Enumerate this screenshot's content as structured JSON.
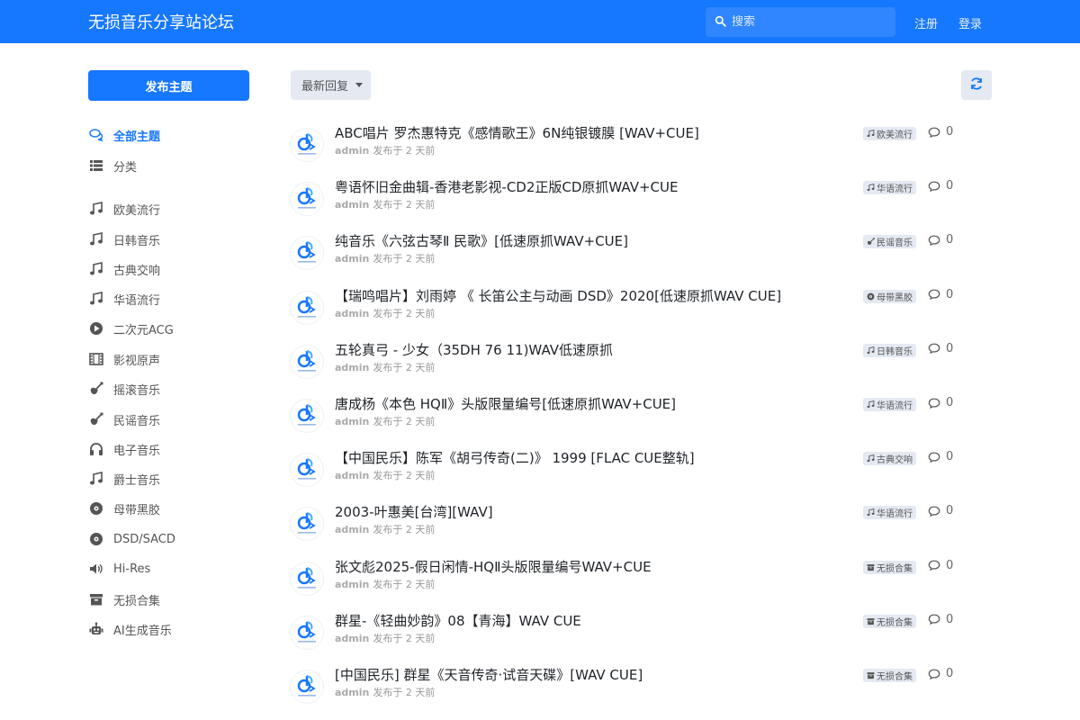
{
  "header": {
    "site_title": "无损音乐分享站论坛",
    "search_placeholder": "搜索",
    "register": "注册",
    "login": "登录"
  },
  "colors": {
    "brand": "#1677ff",
    "tag_bg": "#e4e9f2"
  },
  "sidebar": {
    "post_button": "发布主题",
    "items": [
      {
        "label": "全部主题",
        "icon": "comments-icon",
        "active": true
      },
      {
        "label": "分类",
        "icon": "list-icon"
      },
      {
        "label": "欧美流行",
        "icon": "music-note-icon"
      },
      {
        "label": "日韩音乐",
        "icon": "music-note-icon"
      },
      {
        "label": "古典交响",
        "icon": "music-note-icon"
      },
      {
        "label": "华语流行",
        "icon": "music-note-icon"
      },
      {
        "label": "二次元ACG",
        "icon": "play-circle-icon"
      },
      {
        "label": "影视原声",
        "icon": "film-icon"
      },
      {
        "label": "摇滚音乐",
        "icon": "guitar-icon"
      },
      {
        "label": "民谣音乐",
        "icon": "guitar-icon"
      },
      {
        "label": "电子音乐",
        "icon": "headphones-icon"
      },
      {
        "label": "爵士音乐",
        "icon": "music-note-icon"
      },
      {
        "label": "母带黑胶",
        "icon": "record-icon"
      },
      {
        "label": "DSD/SACD",
        "icon": "record-icon"
      },
      {
        "label": "Hi-Res",
        "icon": "volume-icon"
      },
      {
        "label": "无损合集",
        "icon": "archive-icon"
      },
      {
        "label": "AI生成音乐",
        "icon": "robot-icon"
      }
    ]
  },
  "toolbar": {
    "sort_label": "最新回复"
  },
  "topics": [
    {
      "title": "ABC唱片 罗杰惠特克《感情歌王》6N纯银镀膜 [WAV+CUE]",
      "author": "admin",
      "time": "发布于 2 天前",
      "tag": "欧美流行",
      "tag_icon": "music-note-icon",
      "replies": "0"
    },
    {
      "title": "粤语怀旧金曲辑-香港老影视-CD2正版CD原抓WAV+CUE",
      "author": "admin",
      "time": "发布于 2 天前",
      "tag": "华语流行",
      "tag_icon": "music-note-icon",
      "replies": "0"
    },
    {
      "title": "纯音乐《六弦古琴Ⅱ 民歌》[低速原抓WAV+CUE]",
      "author": "admin",
      "time": "发布于 2 天前",
      "tag": "民谣音乐",
      "tag_icon": "guitar-icon",
      "replies": "0"
    },
    {
      "title": "【瑞鸣唱片】刘雨婷 《 长笛公主与动画 DSD》2020[低速原抓WAV CUE]",
      "author": "admin",
      "time": "发布于 2 天前",
      "tag": "母带黑胶",
      "tag_icon": "record-icon",
      "replies": "0"
    },
    {
      "title": "五轮真弓 - 少女（35DH 76 11)WAV低速原抓",
      "author": "admin",
      "time": "发布于 2 天前",
      "tag": "日韩音乐",
      "tag_icon": "music-note-icon",
      "replies": "0"
    },
    {
      "title": "唐成杨《本色 HQⅡ》头版限量编号[低速原抓WAV+CUE]",
      "author": "admin",
      "time": "发布于 2 天前",
      "tag": "华语流行",
      "tag_icon": "music-note-icon",
      "replies": "0"
    },
    {
      "title": "【中国民乐】陈军《胡弓传奇(二)》 1999 [FLAC CUE整轨]",
      "author": "admin",
      "time": "发布于 2 天前",
      "tag": "古典交响",
      "tag_icon": "music-note-icon",
      "replies": "0"
    },
    {
      "title": "2003-叶惠美[台湾][WAV]",
      "author": "admin",
      "time": "发布于 2 天前",
      "tag": "华语流行",
      "tag_icon": "music-note-icon",
      "replies": "0"
    },
    {
      "title": "张文彪2025-假日闲情-HQⅡ头版限量编号WAV+CUE",
      "author": "admin",
      "time": "发布于 2 天前",
      "tag": "无损合集",
      "tag_icon": "archive-icon",
      "replies": "0"
    },
    {
      "title": "群星-《轻曲妙韵》08【青海】WAV CUE",
      "author": "admin",
      "time": "发布于 2 天前",
      "tag": "无损合集",
      "tag_icon": "archive-icon",
      "replies": "0"
    },
    {
      "title": "[中国民乐] 群星《天音传奇·试音天碟》[WAV CUE]",
      "author": "admin",
      "time": "发布于 2 天前",
      "tag": "无损合集",
      "tag_icon": "archive-icon",
      "replies": "0"
    }
  ]
}
